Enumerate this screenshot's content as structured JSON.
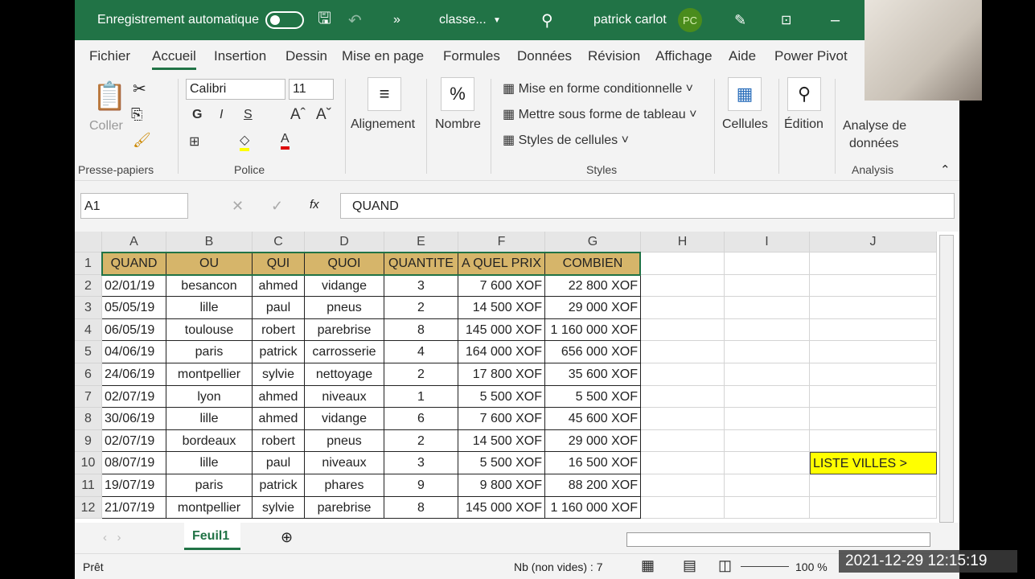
{
  "titlebar": {
    "autosave_label": "Enregistrement automatique",
    "filename": "classe...",
    "user": "patrick carlot",
    "initials": "PC"
  },
  "tabs": [
    "Fichier",
    "Accueil",
    "Insertion",
    "Dessin",
    "Mise en page",
    "Formules",
    "Données",
    "Révision",
    "Affichage",
    "Aide",
    "Power Pivot"
  ],
  "ribbon": {
    "paste": "Coller",
    "clipboard_group": "Presse-papiers",
    "font_name": "Calibri",
    "font_size": "11",
    "bold": "G",
    "italic": "I",
    "underline": "S",
    "font_group": "Police",
    "alignment": "Alignement",
    "number": "Nombre",
    "cond_format": "Mise en forme conditionnelle",
    "format_table": "Mettre sous forme de tableau",
    "cell_styles": "Styles de cellules",
    "styles_group": "Styles",
    "cells": "Cellules",
    "editing": "Édition",
    "analyze1": "Analyse de",
    "analyze2": "données",
    "analysis_group": "Analysis"
  },
  "formula_bar": {
    "name_box": "A1",
    "fx": "fx",
    "value": "QUAND"
  },
  "columns": [
    "A",
    "B",
    "C",
    "D",
    "E",
    "F",
    "G",
    "H",
    "I",
    "J"
  ],
  "headers": [
    "QUAND",
    "OU",
    "QUI",
    "QUOI",
    "QUANTITE",
    "A QUEL PRIX",
    "COMBIEN"
  ],
  "rows": [
    [
      "02/01/19",
      "besancon",
      "ahmed",
      "vidange",
      "3",
      "7 600 XOF",
      "22 800 XOF"
    ],
    [
      "05/05/19",
      "lille",
      "paul",
      "pneus",
      "2",
      "14 500 XOF",
      "29 000 XOF"
    ],
    [
      "06/05/19",
      "toulouse",
      "robert",
      "parebrise",
      "8",
      "145 000 XOF",
      "1 160 000 XOF"
    ],
    [
      "04/06/19",
      "paris",
      "patrick",
      "carrosserie",
      "4",
      "164 000 XOF",
      "656 000 XOF"
    ],
    [
      "24/06/19",
      "montpellier",
      "sylvie",
      "nettoyage",
      "2",
      "17 800 XOF",
      "35 600 XOF"
    ],
    [
      "02/07/19",
      "lyon",
      "ahmed",
      "niveaux",
      "1",
      "5 500 XOF",
      "5 500 XOF"
    ],
    [
      "30/06/19",
      "lille",
      "ahmed",
      "vidange",
      "6",
      "7 600 XOF",
      "45 600 XOF"
    ],
    [
      "02/07/19",
      "bordeaux",
      "robert",
      "pneus",
      "2",
      "14 500 XOF",
      "29 000 XOF"
    ],
    [
      "08/07/19",
      "lille",
      "paul",
      "niveaux",
      "3",
      "5 500 XOF",
      "16 500 XOF"
    ],
    [
      "19/07/19",
      "paris",
      "patrick",
      "phares",
      "9",
      "9 800 XOF",
      "88 200 XOF"
    ],
    [
      "21/07/19",
      "montpellier",
      "sylvie",
      "parebrise",
      "8",
      "145 000 XOF",
      "1 160 000 XOF"
    ]
  ],
  "j10_label": "LISTE VILLES >",
  "sheet_tab": "Feuil1",
  "status": {
    "ready": "Prêt",
    "count": "Nb (non vides) : 7",
    "zoom": "100 %"
  },
  "overlay_clock": "2021-12-29 12:15:19",
  "colors": {
    "excel_green": "#217346",
    "header_fill": "#d6b56a",
    "highlight": "#ffff00"
  }
}
